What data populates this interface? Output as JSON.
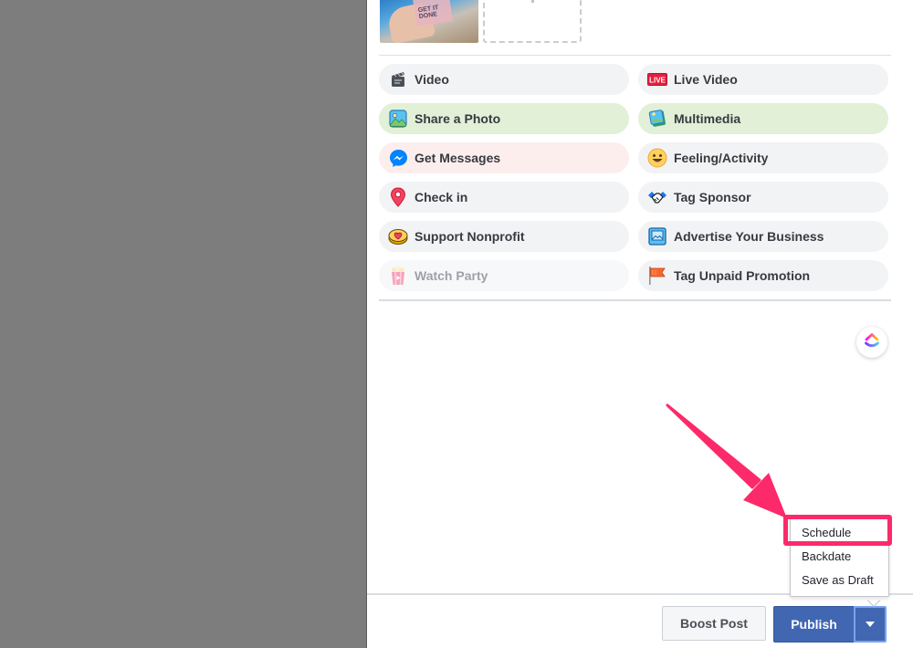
{
  "composer": {
    "thumbnail_alt": "Attached photo thumbnail",
    "thumbnail_caption": "GET IT DONE",
    "options": [
      {
        "label": "Video",
        "icon": "clapperboard-icon",
        "style": "default"
      },
      {
        "label": "Live Video",
        "icon": "live-badge-icon",
        "icon_text": "LIVE",
        "style": "default"
      },
      {
        "label": "Share a Photo",
        "icon": "photo-icon",
        "style": "green"
      },
      {
        "label": "Multimedia",
        "icon": "multimedia-icon",
        "style": "green"
      },
      {
        "label": "Get Messages",
        "icon": "messenger-icon",
        "style": "pink"
      },
      {
        "label": "Feeling/Activity",
        "icon": "smiley-icon",
        "style": "default"
      },
      {
        "label": "Check in",
        "icon": "map-pin-icon",
        "style": "default"
      },
      {
        "label": "Tag Sponsor",
        "icon": "handshake-icon",
        "style": "default"
      },
      {
        "label": "Support Nonprofit",
        "icon": "heart-coin-icon",
        "style": "default"
      },
      {
        "label": "Advertise Your Business",
        "icon": "ad-image-icon",
        "style": "default"
      },
      {
        "label": "Watch Party",
        "icon": "popcorn-icon",
        "style": "disabled"
      },
      {
        "label": "Tag Unpaid Promotion",
        "icon": "flag-icon",
        "style": "default"
      }
    ]
  },
  "footer": {
    "boost_label": "Boost Post",
    "publish_label": "Publish"
  },
  "publish_menu": {
    "items": [
      "Schedule",
      "Backdate",
      "Save as Draft"
    ],
    "highlighted": "Schedule"
  },
  "colors": {
    "primary_blue": "#4267b2",
    "annotation_pink": "#fc2a6a",
    "backdrop_gray": "#7d7d7d"
  }
}
